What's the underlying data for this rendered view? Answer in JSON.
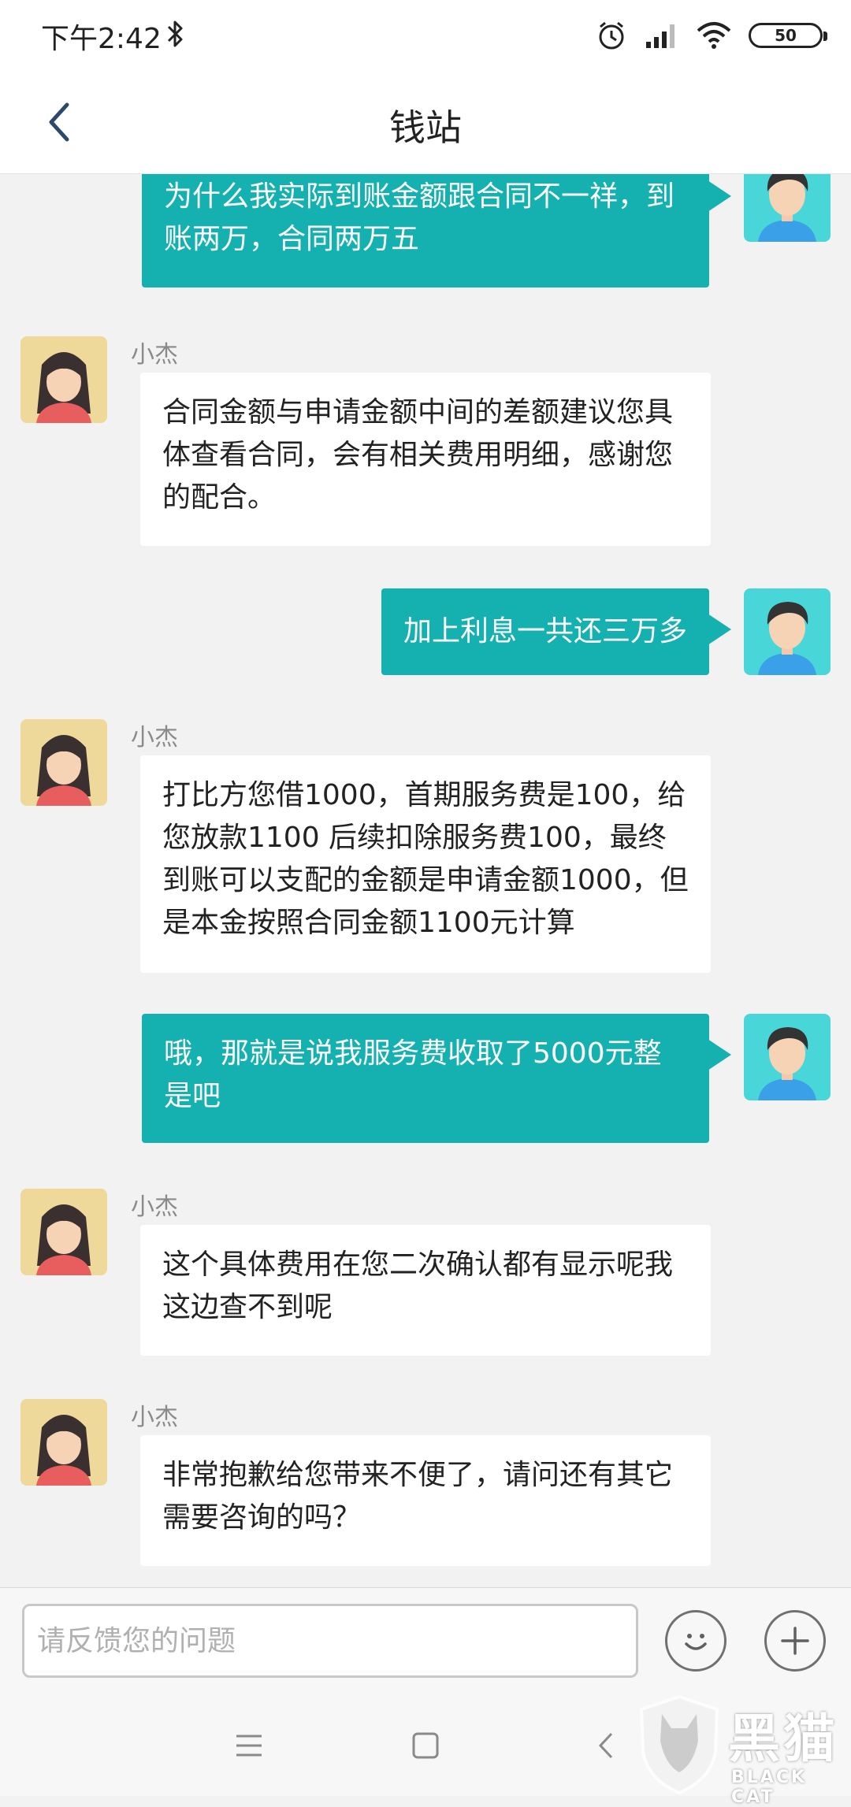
{
  "status_bar": {
    "time": "下午2:42",
    "battery": "50"
  },
  "header": {
    "title": "钱站"
  },
  "messages": [
    {
      "from": "user",
      "text": "为什么我实际到账金额跟合同不一祥，到账两万，合同两万五"
    },
    {
      "from": "agent",
      "sender": "小杰",
      "text": "合同金额与申请金额中间的差额建议您具体查看合同，会有相关费用明细，感谢您的配合。"
    },
    {
      "from": "user",
      "text": "加上利息一共还三万多"
    },
    {
      "from": "agent",
      "sender": "小杰",
      "text": "打比方您借1000，首期服务费是100，给您放款1100 后续扣除服务费100，最终到账可以支配的金额是申请金额1000，但是本金按照合同金额1100元计算"
    },
    {
      "from": "user",
      "text": "哦，那就是说我服务费收取了5000元整是吧"
    },
    {
      "from": "agent",
      "sender": "小杰",
      "text": "这个具体费用在您二次确认都有显示呢我这边查不到呢"
    },
    {
      "from": "agent",
      "sender": "小杰",
      "text": "非常抱歉给您带来不便了，请问还有其它需要咨询的吗？"
    }
  ],
  "input": {
    "placeholder": "请反馈您的问题"
  },
  "watermark": {
    "text": "黑猫",
    "sub": "BLACK CAT"
  },
  "colors": {
    "user_bubble": "#14b1b0",
    "agent_bubble": "#ffffff",
    "background": "#f2f2f2"
  }
}
